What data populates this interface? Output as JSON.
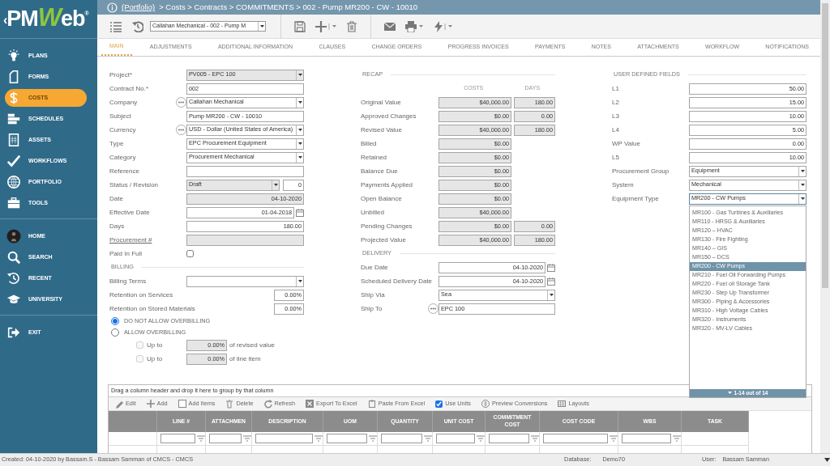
{
  "logo": {
    "lead": "‹",
    "left": "PM",
    "accent": "W",
    "right": "eb",
    "mark": "®"
  },
  "sidebar": {
    "sections": [
      {
        "items": [
          {
            "label": "PLANS",
            "selected": false
          },
          {
            "label": "FORMS",
            "selected": false
          },
          {
            "label": "COSTS",
            "selected": true
          },
          {
            "label": "SCHEDULES",
            "selected": false
          },
          {
            "label": "ASSETS",
            "selected": false
          },
          {
            "label": "WORKFLOWS",
            "selected": false
          },
          {
            "label": "PORTFOLIO",
            "selected": false
          },
          {
            "label": "TOOLS",
            "selected": false
          }
        ]
      },
      {
        "items": [
          {
            "label": "HOME",
            "selected": false
          },
          {
            "label": "SEARCH",
            "selected": false
          },
          {
            "label": "RECENT",
            "selected": false
          },
          {
            "label": "UNIVERSITY",
            "selected": false
          }
        ]
      },
      {
        "items": [
          {
            "label": "EXIT",
            "selected": false
          }
        ]
      }
    ]
  },
  "breadcrumb": {
    "link": "(Portfolio)",
    "path": "> Costs > Contracts > COMMITMENTS > 002 - Pump MR200 - CW - 10010"
  },
  "toolbar": {
    "record_select": "Callahan Mechanical - 002 - Pump M"
  },
  "tabs": [
    {
      "label": "MAIN",
      "selected": true
    },
    {
      "label": "ADJUSTMENTS",
      "selected": false
    },
    {
      "label": "ADDITIONAL INFORMATION",
      "selected": false
    },
    {
      "label": "CLAUSES",
      "selected": false
    },
    {
      "label": "CHANGE ORDERS",
      "selected": false
    },
    {
      "label": "PROGRESS INVOICES",
      "selected": false
    },
    {
      "label": "PAYMENTS",
      "selected": false
    },
    {
      "label": "NOTES",
      "selected": false
    },
    {
      "label": "ATTACHMENTS",
      "selected": false
    },
    {
      "label": "WORKFLOW",
      "selected": false
    },
    {
      "label": "NOTIFICATIONS",
      "selected": false
    }
  ],
  "details": {
    "fields": [
      {
        "label": "Project*",
        "kind": "select",
        "value": "PV005 - EPC 100",
        "disabled": true
      },
      {
        "label": "Contract No.*",
        "kind": "text",
        "value": "002",
        "disabled": false
      },
      {
        "label": "Company",
        "kind": "select",
        "value": "Callahan Mechanical",
        "lookup": true,
        "disabled": false
      },
      {
        "label": "Subject",
        "kind": "text",
        "value": "Pump MR200 - CW - 10010",
        "disabled": false
      },
      {
        "label": "Currency",
        "kind": "select",
        "value": "USD - Dollar (United States of America)",
        "lookup": true,
        "disabled": false
      },
      {
        "label": "Type",
        "kind": "select",
        "value": "EPC Procurement Equipment",
        "disabled": false
      },
      {
        "label": "Category",
        "kind": "select",
        "value": "Procurement Mechanical",
        "disabled": false
      },
      {
        "label": "Reference",
        "kind": "text",
        "disabled": false
      },
      {
        "label": "Status / Revision",
        "kind": "status",
        "value": "Draft",
        "revision": "0",
        "disabled": true
      },
      {
        "label": "Date",
        "kind": "number",
        "value": "04-10-2020",
        "disabled": true
      },
      {
        "label": "Effective Date",
        "kind": "date",
        "value": "01-04-2018",
        "disabled": false
      },
      {
        "label": "Days",
        "kind": "number",
        "value": "180.00",
        "disabled": false
      },
      {
        "label": "Procurement #",
        "kind": "number",
        "link": true,
        "disabled": true
      },
      {
        "label": "Paid In Full",
        "kind": "checkbox",
        "checked": false,
        "disabled": false
      }
    ]
  },
  "billing": {
    "title": "BILLING",
    "fields": [
      {
        "label": "Billing Terms",
        "kind": "select",
        "disabled": false
      },
      {
        "label": "Retention on Services",
        "kind": "percent",
        "value": "0.00%",
        "disabled": false
      },
      {
        "label": "Retention on Stored Materials",
        "kind": "percent",
        "value": "0.00%",
        "disabled": false
      }
    ],
    "overbilling": [
      {
        "label": "DO NOT ALLOW OVERBILLING",
        "selected": true
      },
      {
        "label": "ALLOW OVERBILLING",
        "selected": false
      }
    ],
    "limits": [
      {
        "label": "Up to",
        "checked": false,
        "disabled": true,
        "value": "0.00%",
        "suffix": "of revised value"
      },
      {
        "label": "Up to",
        "checked": false,
        "disabled": true,
        "value": "0.00%",
        "suffix": "of line item"
      }
    ]
  },
  "recap": {
    "title": "RECAP",
    "columns": [
      "COSTS",
      "DAYS"
    ],
    "rows": [
      {
        "label": "Original Value",
        "cost": "$40,000.00",
        "days": "180.00"
      },
      {
        "label": "Approved Changes",
        "cost": "$0.00",
        "days": "0.00"
      },
      {
        "label": "Revised Value",
        "cost": "$40,000.00",
        "days": "180.00"
      },
      {
        "label": "Billed",
        "cost": "$0.00"
      },
      {
        "label": "Retained",
        "cost": "$0.00"
      },
      {
        "label": "Balance Due",
        "cost": "$0.00"
      },
      {
        "label": "Payments Applied",
        "cost": "$0.00"
      },
      {
        "label": "Open Balance",
        "cost": "$0.00"
      },
      {
        "label": "Unbilled",
        "cost": "$40,000.00"
      },
      {
        "label": "Pending Changes",
        "cost": "$0.00",
        "days": "0.00"
      },
      {
        "label": "Projected Value",
        "cost": "$40,000.00",
        "days": "180.00"
      }
    ]
  },
  "delivery": {
    "title": "DELIVERY",
    "fields": [
      {
        "label": "Due Date",
        "kind": "date",
        "value": "04-10-2020",
        "disabled": false
      },
      {
        "label": "Scheduled Delivery Date",
        "kind": "date",
        "value": "04-10-2020",
        "disabled": false
      },
      {
        "label": "Ship Via",
        "kind": "select",
        "value": "Sea",
        "disabled": false
      },
      {
        "label": "Ship To",
        "kind": "text",
        "value": "EPC 100",
        "lookup": true,
        "disabled": false
      }
    ]
  },
  "user_defined": {
    "title": "USER DEFINED FIELDS",
    "fields": [
      {
        "label": "L1",
        "kind": "number",
        "value": "50.00",
        "disabled": false
      },
      {
        "label": "L2",
        "kind": "number",
        "value": "15.00",
        "disabled": false
      },
      {
        "label": "L3",
        "kind": "number",
        "value": "10.00",
        "disabled": false
      },
      {
        "label": "L4",
        "kind": "number",
        "value": "5.00",
        "disabled": false
      },
      {
        "label": "WP Value",
        "kind": "number",
        "value": "0.00",
        "disabled": false
      },
      {
        "label": "L5",
        "kind": "number",
        "value": "10.00",
        "disabled": false
      },
      {
        "label": "Procurement Group",
        "kind": "select",
        "value": "Equipment",
        "disabled": false
      },
      {
        "label": "System",
        "kind": "select",
        "value": "Mechanical",
        "disabled": false
      },
      {
        "label": "Equipment Type",
        "kind": "select",
        "value": "MR200 - CW Pumps",
        "disabled": false,
        "expanded": true,
        "pager": "1-14 out of 14",
        "options": [
          {
            "label": "MR100 - Gas Turbines & Auxiliaries",
            "selected": false
          },
          {
            "label": "MR110 - HRSG & Auxiliaries",
            "selected": false
          },
          {
            "label": "MR120 – HVAC",
            "selected": false
          },
          {
            "label": "MR130 - Fire Fighting",
            "selected": false
          },
          {
            "label": "MR140 – GIS",
            "selected": false
          },
          {
            "label": "MR150 – DCS",
            "selected": false
          },
          {
            "label": "MR200 - CW Pumps",
            "selected": true
          },
          {
            "label": "MR210 - Fuel Oil Forwarding Pumps",
            "selected": false
          },
          {
            "label": "MR220 - Fuel oil Storage Tank",
            "selected": false
          },
          {
            "label": "MR230 - Step Up Transformer",
            "selected": false
          },
          {
            "label": "MR300 - Piping & Accessories",
            "selected": false
          },
          {
            "label": "MR310 - High Voltage Cables",
            "selected": false
          },
          {
            "label": "MR320 - Instruments",
            "selected": false
          },
          {
            "label": "MR320 - MV-LV Cables",
            "selected": false
          }
        ]
      }
    ]
  },
  "grid": {
    "group_hint": "Drag a column header and drop it here to group by that column",
    "actions": [
      {
        "label": "Edit",
        "kind": "button"
      },
      {
        "label": "Add",
        "kind": "button"
      },
      {
        "label": "Add Items",
        "kind": "button"
      },
      {
        "label": "Delete",
        "kind": "button"
      },
      {
        "label": "Refresh",
        "kind": "button"
      },
      {
        "label": "Export To Excel",
        "kind": "button"
      },
      {
        "label": "Paste From Excel",
        "kind": "button"
      },
      {
        "label": "Use Units",
        "kind": "checkbox",
        "checked": true
      },
      {
        "label": "Preview Conversions",
        "kind": "button"
      },
      {
        "label": "Layouts",
        "kind": "button"
      }
    ],
    "columns": [
      {
        "label": "LINE #",
        "filter": true
      },
      {
        "label": "ATTACHMEN",
        "filter": true
      },
      {
        "label": "DESCRIPTION",
        "filter": true
      },
      {
        "label": "UOM",
        "filter": true
      },
      {
        "label": "QUANTITY",
        "filter": true
      },
      {
        "label": "UNIT COST",
        "filter": true
      },
      {
        "label": "COMMITMENT COST",
        "filter": true
      },
      {
        "label": "COST CODE",
        "filter": true
      },
      {
        "label": "WBS",
        "filter": true
      },
      {
        "label": "TASK",
        "filter": false
      }
    ]
  },
  "status_bar": {
    "created": "Created:  04-10-2020 by Bassam.S - Bassam Samman of CMCS - CMCS",
    "database_label": "Database:",
    "database": "Demo70",
    "user_label": "User:",
    "user": "Bassam Samman"
  }
}
